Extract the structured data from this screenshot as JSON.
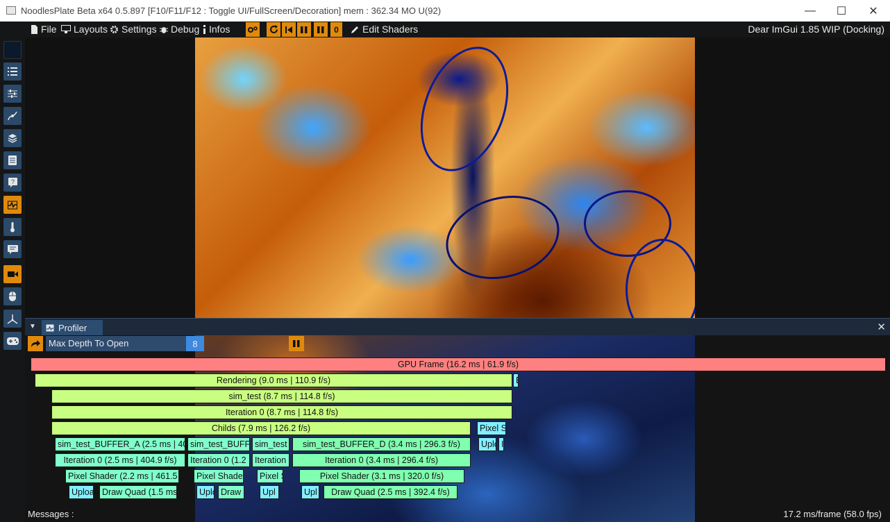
{
  "window": {
    "title": "NoodlesPlate Beta x64 0.5.897 [F10/F11/F12 : Toggle UI/FullScreen/Decoration] mem : 362.34 MO U(92)",
    "minimize": "—",
    "maximize": "☐",
    "close": "✕"
  },
  "menubar": {
    "items": [
      {
        "label": "File",
        "icon": "file-icon"
      },
      {
        "label": "Layouts",
        "icon": "monitor-icon"
      },
      {
        "label": "Settings",
        "icon": "gear-icon"
      },
      {
        "label": "Debug",
        "icon": "bug-icon"
      },
      {
        "label": "Infos",
        "icon": "info-icon"
      }
    ],
    "frame_counter": "0",
    "edit_shaders": "Edit Shaders",
    "imgui_version": "Dear ImGui 1.85 WIP (Docking)"
  },
  "sidebar": {
    "buttons": [
      {
        "name": "color-swatch",
        "icon": "color-swatch-icon"
      },
      {
        "name": "list",
        "icon": "list-icon"
      },
      {
        "name": "sliders",
        "icon": "sliders-icon"
      },
      {
        "name": "curve",
        "icon": "curve-icon"
      },
      {
        "name": "layers",
        "icon": "layers-icon"
      },
      {
        "name": "document",
        "icon": "document-icon"
      },
      {
        "name": "help",
        "icon": "help-icon"
      },
      {
        "name": "profiler",
        "icon": "profiler-icon",
        "active": true
      },
      {
        "name": "thermometer",
        "icon": "thermometer-icon"
      },
      {
        "name": "comments",
        "icon": "comments-icon"
      },
      {
        "name": "camera",
        "icon": "camera-icon",
        "active": true
      },
      {
        "name": "mouse",
        "icon": "mouse-icon"
      },
      {
        "name": "axes",
        "icon": "axes-icon"
      },
      {
        "name": "gamepad",
        "icon": "gamepad-icon"
      }
    ]
  },
  "profiler": {
    "tab_label": "Profiler",
    "max_depth_label": "Max Depth To Open",
    "max_depth_value": "8",
    "rows": [
      [
        {
          "text": "GPU Frame (16.2 ms | 61.9 f/s)",
          "color": "#ff8080"
        }
      ],
      [
        {
          "text": "Rendering (9.0 ms | 110.9 f/s)",
          "color": "#c9ff80"
        },
        {
          "text": "B",
          "color": "#80f0ff"
        }
      ],
      [
        {
          "text": "sim_test (8.7 ms | 114.8 f/s)",
          "color": "#c9ff80"
        }
      ],
      [
        {
          "text": "Iteration 0 (8.7 ms | 114.8 f/s)",
          "color": "#c9ff80"
        }
      ],
      [
        {
          "text": "Childs (7.9 ms | 126.2 f/s)",
          "color": "#c9ff80"
        },
        {
          "text": "Pixel S",
          "color": "#80f0ff"
        }
      ],
      [
        {
          "text": "sim_test_BUFFER_A (2.5 ms | 40",
          "color": "#80ffcc"
        },
        {
          "text": "sim_test_BUFF",
          "color": "#80ffcc"
        },
        {
          "text": "sim_test",
          "color": "#80ffcc"
        },
        {
          "text": "sim_test_BUFFER_D (3.4 ms | 296.3 f/s)",
          "color": "#80ffb0"
        },
        {
          "text": "Uplo",
          "color": "#80f0ff"
        },
        {
          "text": "I",
          "color": "#80f0ff"
        }
      ],
      [
        {
          "text": "Iteration 0 (2.5 ms | 404.9 f/s)",
          "color": "#80ffcc"
        },
        {
          "text": "Iteration 0 (1.2",
          "color": "#80ffcc"
        },
        {
          "text": "Iteration",
          "color": "#80ffcc"
        },
        {
          "text": "Iteration 0 (3.4 ms | 296.4 f/s)",
          "color": "#80ffb0"
        }
      ],
      [
        {
          "text": "Pixel Shader (2.2 ms | 461.5",
          "color": "#80ffcc"
        },
        {
          "text": "Pixel Shade",
          "color": "#80ffcc"
        },
        {
          "text": "Pixel S",
          "color": "#80ffcc"
        },
        {
          "text": "Pixel Shader (3.1 ms | 320.0 f/s)",
          "color": "#80ffb0"
        }
      ],
      [
        {
          "text": "Uploa",
          "color": "#80f0ff"
        },
        {
          "text": "Draw Quad (1.5 ms",
          "color": "#80ffcc"
        },
        {
          "text": "Uplo",
          "color": "#80f0ff"
        },
        {
          "text": "Draw",
          "color": "#80ffcc"
        },
        {
          "text": "Upl",
          "color": "#80f0ff"
        },
        {
          "text": "Upl",
          "color": "#80f0ff"
        },
        {
          "text": "Draw Quad (2.5 ms | 392.4 f/s)",
          "color": "#80ffb0"
        }
      ]
    ]
  },
  "status": {
    "messages_label": "Messages :",
    "fps": "17.2 ms/frame (58.0 fps)"
  }
}
